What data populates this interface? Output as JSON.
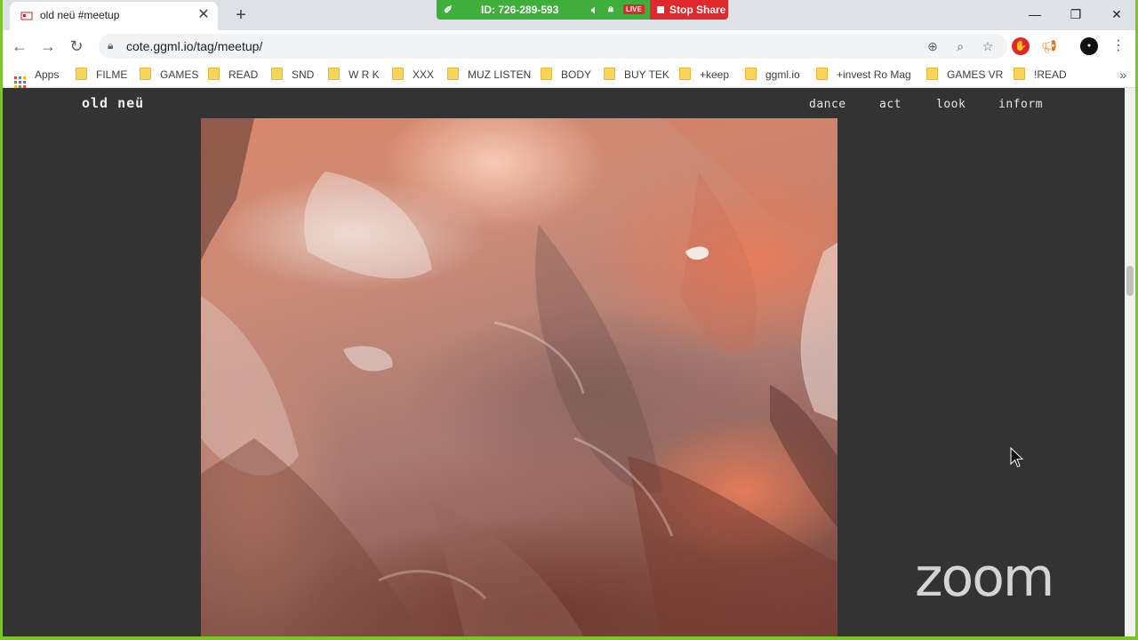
{
  "browser": {
    "tab_title": "old neü #meetup",
    "url": "cote.ggml.io/tag/meetup/"
  },
  "zoom": {
    "meeting_id": "ID: 726-289-593",
    "live_badge": "LIVE",
    "stop_share_label": "Stop Share",
    "watermark": "zoom"
  },
  "bookmarks": {
    "apps_label": "Apps",
    "items": [
      {
        "label": "FILME"
      },
      {
        "label": "GAMES"
      },
      {
        "label": "READ"
      },
      {
        "label": "SND"
      },
      {
        "label": "W R K"
      },
      {
        "label": "XXX"
      },
      {
        "label": "MUZ LISTEN"
      },
      {
        "label": "BODY"
      },
      {
        "label": "BUY TEK"
      },
      {
        "label": "+keep"
      },
      {
        "label": "ggml.io"
      },
      {
        "label": "+invest Ro Mag"
      },
      {
        "label": "GAMES VR"
      },
      {
        "label": "!READ"
      }
    ]
  },
  "site": {
    "logo": "old neü",
    "nav": [
      {
        "label": "dance"
      },
      {
        "label": "act"
      },
      {
        "label": "look"
      },
      {
        "label": "inform"
      }
    ]
  }
}
